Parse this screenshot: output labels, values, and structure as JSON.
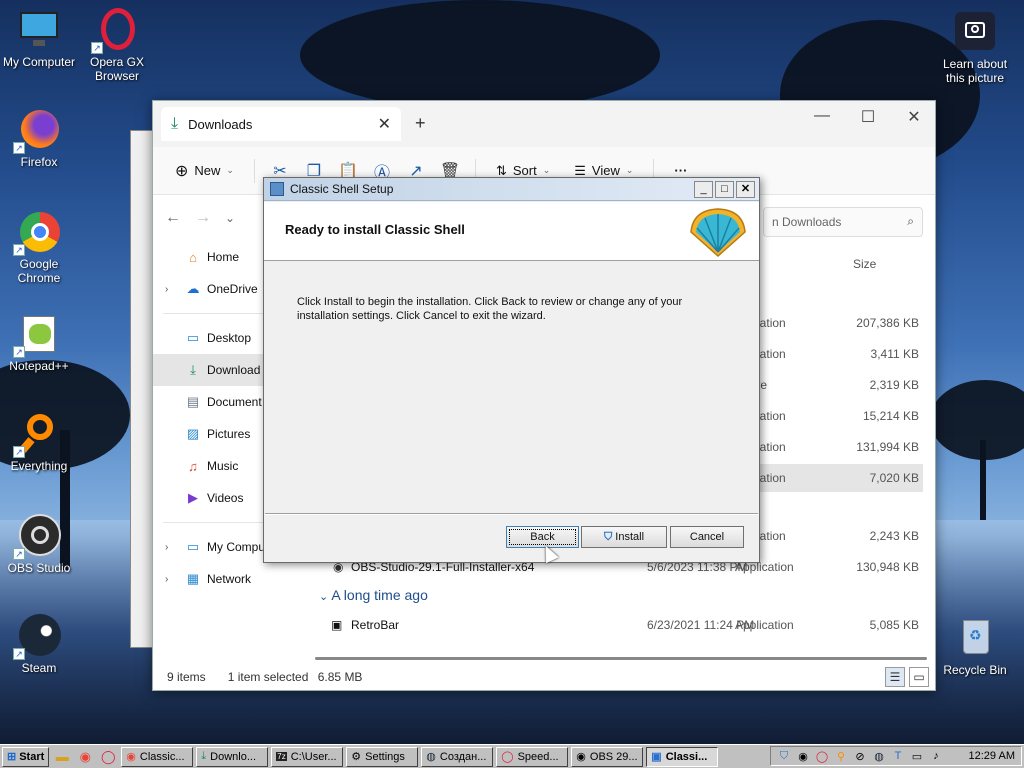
{
  "desktop": {
    "icons": [
      {
        "label": "My Computer",
        "icon": "monitor-icon"
      },
      {
        "label": "Opera GX Browser",
        "icon": "opera-gx-icon"
      },
      {
        "label": "Firefox",
        "icon": "firefox-icon"
      },
      {
        "label": "Google Chrome",
        "icon": "chrome-icon"
      },
      {
        "label": "Notepad++",
        "icon": "notepad-plus-plus-icon"
      },
      {
        "label": "Everything",
        "icon": "everything-search-icon"
      },
      {
        "label": "OBS Studio",
        "icon": "obs-studio-icon"
      },
      {
        "label": "Steam",
        "icon": "steam-icon"
      },
      {
        "label": "Learn about this picture",
        "icon": "camera-icon"
      },
      {
        "label": "Recycle Bin",
        "icon": "recycle-bin-icon"
      }
    ]
  },
  "explorer": {
    "tab_title": "Downloads",
    "toolbar": {
      "new_label": "New",
      "sort_label": "Sort",
      "view_label": "View",
      "more_label": "···"
    },
    "search_placeholder": "Search Downloads",
    "search_visible_text": "n Downloads",
    "nav": {
      "home": "Home",
      "onedrive": "OneDrive",
      "desktop": "Desktop",
      "downloads": "Download",
      "documents": "Document",
      "pictures": "Pictures",
      "music": "Music",
      "videos": "Videos",
      "my_computer": "My Computer",
      "network": "Network"
    },
    "column_size": "Size",
    "rows": [
      {
        "name": "",
        "date": "",
        "type": "pplication",
        "size": "207,386 KB"
      },
      {
        "name": "",
        "date": "",
        "type": "pplication",
        "size": "3,411 KB"
      },
      {
        "name": "",
        "date": "",
        "type": "rchive",
        "size": "2,319 KB"
      },
      {
        "name": "",
        "date": "",
        "type": "pplication",
        "size": "15,214 KB"
      },
      {
        "name": "",
        "date": "",
        "type": "pplication",
        "size": "131,994 KB"
      },
      {
        "name": "",
        "date": "",
        "type": "pplication",
        "size": "7,020 KB"
      },
      {
        "name": "",
        "date": "",
        "type": "pplication",
        "size": "2,243 KB"
      },
      {
        "name": "OBS-Studio-29.1-Full-Installer-x64",
        "date": "5/6/2023 11:38 PM",
        "type": "Application",
        "size": "130,948 KB"
      }
    ],
    "group_old": "A long time ago",
    "old_rows": [
      {
        "name": "RetroBar",
        "date": "6/23/2021 11:24 PM",
        "type": "Application",
        "size": "5,085 KB"
      }
    ],
    "status": {
      "items": "9 items",
      "selected": "1 item selected",
      "selected_size": "6.85 MB"
    }
  },
  "setup": {
    "title": "Classic Shell Setup",
    "heading": "Ready to install Classic Shell",
    "body_line1": "Click Install to begin the installation. Click Back to review or change any of your",
    "body_line2": "installation settings. Click Cancel to exit the wizard.",
    "back_label": "Back",
    "install_label": "Install",
    "cancel_label": "Cancel",
    "min_glyph": "_",
    "max_glyph": "□",
    "close_glyph": "✕"
  },
  "taskbar": {
    "start_label": "Start",
    "tasks": [
      {
        "label": "Classic...",
        "icon": "chrome-icon",
        "active": false
      },
      {
        "label": "Downlo...",
        "icon": "downloads-icon",
        "active": false
      },
      {
        "label": "C:\\User...",
        "icon": "7zip-icon",
        "active": false
      },
      {
        "label": "Settings",
        "icon": "gear-icon",
        "active": false
      },
      {
        "label": "Создан...",
        "icon": "steam-icon",
        "active": false
      },
      {
        "label": "Speed...",
        "icon": "opera-gx-icon",
        "active": false
      },
      {
        "label": "OBS 29...",
        "icon": "obs-studio-icon",
        "active": false
      },
      {
        "label": "Classi...",
        "icon": "classic-shell-icon",
        "active": true
      }
    ],
    "clock": "12:29 AM"
  }
}
